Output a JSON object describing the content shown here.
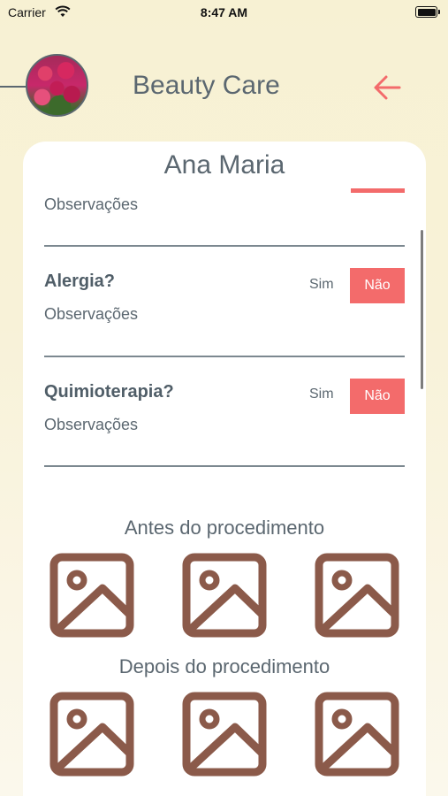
{
  "status_bar": {
    "carrier": "Carrier",
    "time": "8:47 AM"
  },
  "header": {
    "title": "Beauty Care"
  },
  "client": {
    "name": "Ana Maria"
  },
  "sections": {
    "first": {
      "observations_label": "Observações"
    },
    "alergia": {
      "question": "Alergia?",
      "sim_label": "Sim",
      "nao_label": "Não",
      "observations_label": "Observações"
    },
    "quimioterapia": {
      "question": "Quimioterapia?",
      "sim_label": "Sim",
      "nao_label": "Não",
      "observations_label": "Observações"
    }
  },
  "photos": {
    "before_title": "Antes do procedimento",
    "after_title": "Depois do procedimento"
  },
  "colors": {
    "accent": "#f36b6b",
    "text": "#5b6770",
    "photo_icon": "#8b5a4a"
  },
  "icons": [
    "wifi-icon",
    "battery-icon",
    "back-arrow-icon",
    "image-placeholder-icon"
  ]
}
